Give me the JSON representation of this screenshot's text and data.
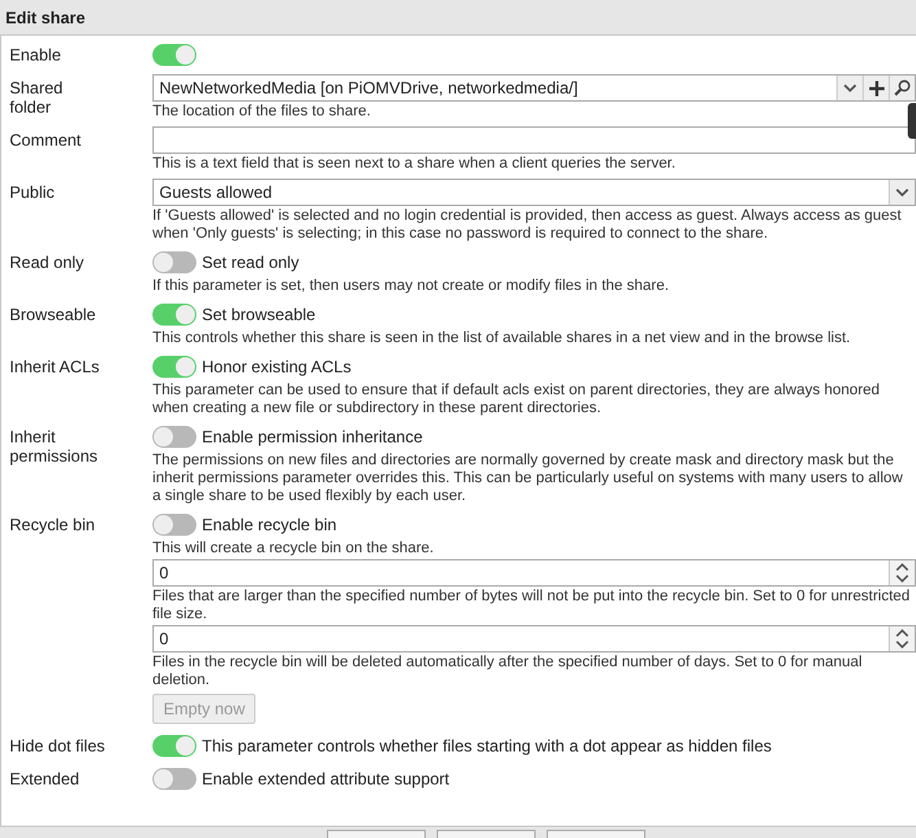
{
  "title": "Edit share",
  "rows": [
    {
      "label": "Enable",
      "items": [
        {
          "kind": "toggle",
          "on": true
        }
      ]
    },
    {
      "label": "Shared folder",
      "items": [
        {
          "kind": "combo",
          "value": "NewNetworkedMedia [on PiOMVDrive, networkedmedia/]"
        },
        {
          "kind": "hint",
          "text": "The location of the files to share."
        }
      ]
    },
    {
      "label": "Comment",
      "items": [
        {
          "kind": "text"
        },
        {
          "kind": "hint",
          "text": "This is a text field that is seen next to a share when a client queries the server."
        }
      ]
    },
    {
      "label": "Public",
      "items": [
        {
          "kind": "select",
          "value": "Guests allowed"
        },
        {
          "kind": "hint",
          "text": "If 'Guests allowed' is selected and no login credential is provided, then access as guest. Always access as guest when 'Only guests' is selecting; in this case no password is required to connect to the share."
        }
      ]
    },
    {
      "label": "Read only",
      "items": [
        {
          "kind": "toggle",
          "on": false,
          "text": "Set read only"
        },
        {
          "kind": "hint",
          "text": "If this parameter is set, then users may not create or modify files in the share."
        }
      ]
    },
    {
      "label": "Browseable",
      "items": [
        {
          "kind": "toggle",
          "on": true,
          "text": "Set browseable"
        },
        {
          "kind": "hint",
          "text": "This controls whether this share is seen in the list of available shares in a net view and in the browse list."
        }
      ]
    },
    {
      "label": "Inherit ACLs",
      "items": [
        {
          "kind": "toggle",
          "on": true,
          "text": "Honor existing ACLs"
        },
        {
          "kind": "hint",
          "text": "This parameter can be used to ensure that if default acls exist on parent directories, they are always honored when creating a new file or subdirectory in these parent directories."
        }
      ]
    },
    {
      "label": "Inherit permissions",
      "items": [
        {
          "kind": "toggle",
          "on": false,
          "text": "Enable permission inheritance"
        },
        {
          "kind": "hint",
          "text": "The permissions on new files and directories are normally governed by create mask and directory mask but the inherit permissions parameter overrides this. This can be particularly useful on systems with many users to allow a single share to be used flexibly by each user."
        }
      ]
    },
    {
      "label": "Recycle bin",
      "items": [
        {
          "kind": "toggle",
          "on": false,
          "text": "Enable recycle bin"
        },
        {
          "kind": "hint",
          "text": "This will create a recycle bin on the share."
        },
        {
          "kind": "number",
          "value": "0"
        },
        {
          "kind": "hint",
          "text": "Files that are larger than the specified number of bytes will not be put into the recycle bin. Set to 0 for unrestricted file size."
        },
        {
          "kind": "number",
          "value": "0"
        },
        {
          "kind": "hint",
          "text": "Files in the recycle bin will be deleted automatically after the specified number of days. Set to 0 for manual deletion."
        },
        {
          "kind": "button",
          "text": "Empty now",
          "disabled": true
        }
      ]
    },
    {
      "label": "Hide dot files",
      "items": [
        {
          "kind": "toggle",
          "on": true,
          "text": "This parameter controls whether files starting with a dot appear as hidden files"
        }
      ]
    },
    {
      "label": "Extended",
      "items": [
        {
          "kind": "toggle",
          "on": false,
          "text": "Enable extended attribute support"
        }
      ]
    }
  ]
}
